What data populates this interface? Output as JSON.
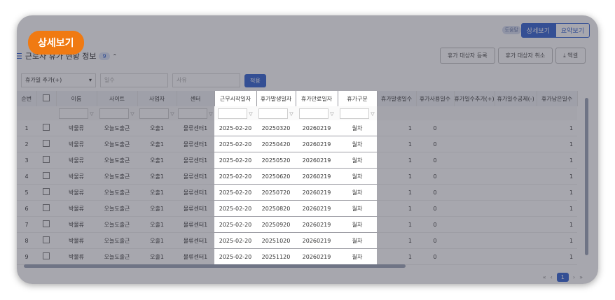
{
  "tag_label": "상세보기",
  "view_toggle": {
    "active": "상세보기",
    "inactive": "요약보기"
  },
  "small_badge": "도움말",
  "section": {
    "title": "근로자 휴가 현황 정보",
    "count": "9"
  },
  "actions": {
    "register": "휴가 대상자 등록",
    "cancel": "휴가 대상자 취소",
    "excel": "엑셀"
  },
  "filters": {
    "select": "휴가일 추가(+)",
    "days_placeholder": "일수",
    "reason_placeholder": "사유",
    "apply": "적용"
  },
  "columns": [
    "순번",
    "",
    "이름",
    "사이트",
    "사업자",
    "센터",
    "근무시작일자",
    "휴가발생일자",
    "휴가만료일자",
    "휴가구분",
    "휴가발생일수",
    "휴가사용일수",
    "휴가일수추가(+)",
    "휴가일수공제(-)",
    "휴가남은일수"
  ],
  "rows": [
    {
      "no": "1",
      "name": "박물류",
      "site": "오늘도출근",
      "biz": "오출1",
      "center": "물류센터1",
      "start": "2025-02-20",
      "issued": "20250320",
      "expire": "20260219",
      "type": "월차",
      "gen": "1",
      "used": "0",
      "remain": "1"
    },
    {
      "no": "2",
      "name": "박물류",
      "site": "오늘도출근",
      "biz": "오출1",
      "center": "물류센터1",
      "start": "2025-02-20",
      "issued": "20250420",
      "expire": "20260219",
      "type": "월차",
      "gen": "1",
      "used": "0",
      "remain": "1"
    },
    {
      "no": "3",
      "name": "박물류",
      "site": "오늘도출근",
      "biz": "오출1",
      "center": "물류센터1",
      "start": "2025-02-20",
      "issued": "20250520",
      "expire": "20260219",
      "type": "월차",
      "gen": "1",
      "used": "0",
      "remain": "1"
    },
    {
      "no": "4",
      "name": "박물류",
      "site": "오늘도출근",
      "biz": "오출1",
      "center": "물류센터1",
      "start": "2025-02-20",
      "issued": "20250620",
      "expire": "20260219",
      "type": "월차",
      "gen": "1",
      "used": "0",
      "remain": "1"
    },
    {
      "no": "5",
      "name": "박물류",
      "site": "오늘도출근",
      "biz": "오출1",
      "center": "물류센터1",
      "start": "2025-02-20",
      "issued": "20250720",
      "expire": "20260219",
      "type": "월차",
      "gen": "1",
      "used": "0",
      "remain": "1"
    },
    {
      "no": "6",
      "name": "박물류",
      "site": "오늘도출근",
      "biz": "오출1",
      "center": "물류센터1",
      "start": "2025-02-20",
      "issued": "20250820",
      "expire": "20260219",
      "type": "월차",
      "gen": "1",
      "used": "0",
      "remain": "1"
    },
    {
      "no": "7",
      "name": "박물류",
      "site": "오늘도출근",
      "biz": "오출1",
      "center": "물류센터1",
      "start": "2025-02-20",
      "issued": "20250920",
      "expire": "20260219",
      "type": "월차",
      "gen": "1",
      "used": "0",
      "remain": "1"
    },
    {
      "no": "8",
      "name": "박물류",
      "site": "오늘도출근",
      "biz": "오출1",
      "center": "물류센터1",
      "start": "2025-02-20",
      "issued": "20251020",
      "expire": "20260219",
      "type": "월차",
      "gen": "1",
      "used": "0",
      "remain": "1"
    },
    {
      "no": "9",
      "name": "박물류",
      "site": "오늘도출근",
      "biz": "오출1",
      "center": "물류센터1",
      "start": "2025-02-20",
      "issued": "20251120",
      "expire": "20260219",
      "type": "월차",
      "gen": "1",
      "used": "0",
      "remain": "1"
    }
  ],
  "pager": {
    "current": "1"
  },
  "colors": {
    "accent": "#2f5fd0",
    "tag": "#f07a12"
  }
}
